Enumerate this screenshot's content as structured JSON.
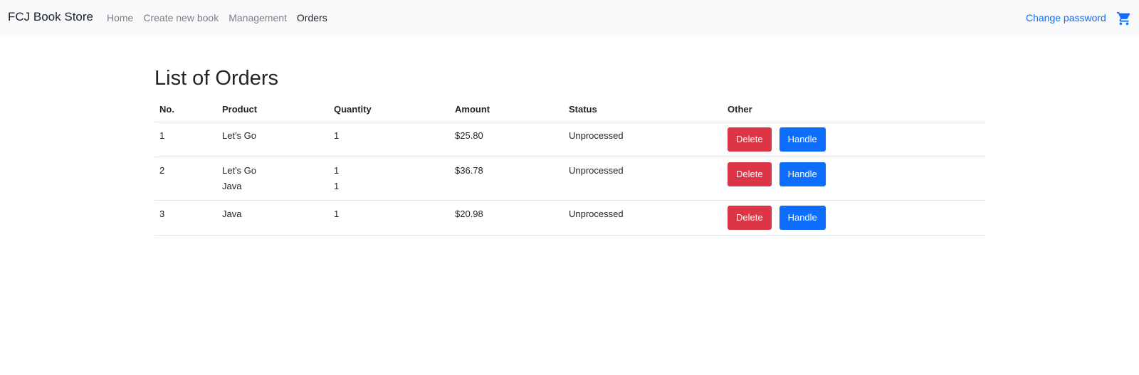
{
  "navbar": {
    "brand": "FCJ Book Store",
    "links": [
      {
        "label": "Home",
        "active": false
      },
      {
        "label": "Create new book",
        "active": false
      },
      {
        "label": "Management",
        "active": false
      },
      {
        "label": "Orders",
        "active": true
      }
    ],
    "change_password": "Change password",
    "cart_icon": "shopping-cart-icon",
    "accent_color": "#0d6efd"
  },
  "page": {
    "title": "List of Orders"
  },
  "table": {
    "headers": {
      "no": "No.",
      "product": "Product",
      "quantity": "Quantity",
      "amount": "Amount",
      "status": "Status",
      "other": "Other"
    },
    "rows": [
      {
        "no": "1",
        "products": [
          "Let's Go"
        ],
        "quantities": [
          "1"
        ],
        "amount": "$25.80",
        "status": "Unprocessed",
        "delete_label": "Delete",
        "handle_label": "Handle"
      },
      {
        "no": "2",
        "products": [
          "Let's Go",
          "Java"
        ],
        "quantities": [
          "1",
          "1"
        ],
        "amount": "$36.78",
        "status": "Unprocessed",
        "delete_label": "Delete",
        "handle_label": "Handle"
      },
      {
        "no": "3",
        "products": [
          "Java"
        ],
        "quantities": [
          "1"
        ],
        "amount": "$20.98",
        "status": "Unprocessed",
        "delete_label": "Delete",
        "handle_label": "Handle"
      }
    ],
    "delete_color": "#dc3545",
    "handle_color": "#0d6efd"
  }
}
